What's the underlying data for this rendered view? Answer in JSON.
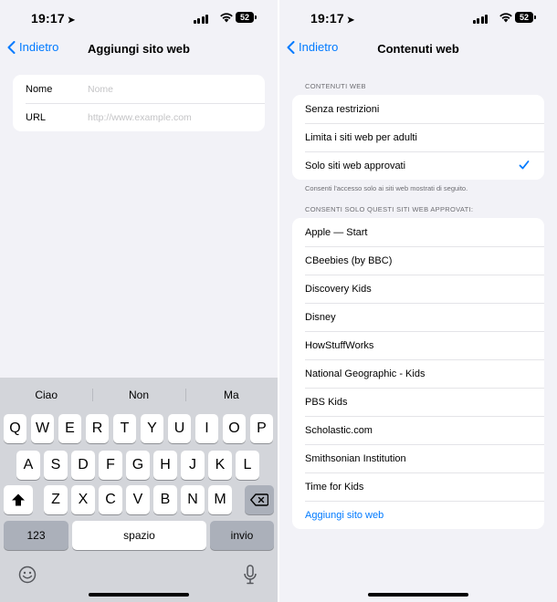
{
  "status": {
    "time": "19:17",
    "battery": "52"
  },
  "left": {
    "nav": {
      "back_label": "Indietro",
      "title": "Aggiungi sito web"
    },
    "form": {
      "name_label": "Nome",
      "name_placeholder": "Nome",
      "url_label": "URL",
      "url_placeholder": "http://www.example.com"
    },
    "keyboard": {
      "suggestions": [
        "Ciao",
        "Non",
        "Ma"
      ],
      "row1": [
        "Q",
        "W",
        "E",
        "R",
        "T",
        "Y",
        "U",
        "I",
        "O",
        "P"
      ],
      "row2": [
        "A",
        "S",
        "D",
        "F",
        "G",
        "H",
        "J",
        "K",
        "L"
      ],
      "row3": [
        "Z",
        "X",
        "C",
        "V",
        "B",
        "N",
        "M"
      ],
      "numbers_key": "123",
      "space_key": "spazio",
      "return_key": "invio",
      "icons": [
        "shift-icon",
        "delete-icon",
        "emoji-icon",
        "microphone-icon"
      ]
    }
  },
  "right": {
    "nav": {
      "back_label": "Indietro",
      "title": "Contenuti web"
    },
    "section1_header": "CONTENUTI WEB",
    "options": [
      {
        "label": "Senza restrizioni",
        "selected": false
      },
      {
        "label": "Limita i siti web per adulti",
        "selected": false
      },
      {
        "label": "Solo siti web approvati",
        "selected": true
      }
    ],
    "footnote": "Consenti l'accesso solo ai siti web mostrati di seguito.",
    "section2_header": "CONSENTI SOLO QUESTI SITI WEB APPROVATI:",
    "sites": [
      "Apple — Start",
      "CBeebies (by BBC)",
      "Discovery Kids",
      "Disney",
      "HowStuffWorks",
      "National Geographic - Kids",
      "PBS Kids",
      "Scholastic.com",
      "Smithsonian Institution",
      "Time for Kids"
    ],
    "add_site_label": "Aggiungi sito web"
  },
  "colors": {
    "accent": "#007aff",
    "background": "#f2f2f7",
    "keyboard": "#d3d5da"
  }
}
